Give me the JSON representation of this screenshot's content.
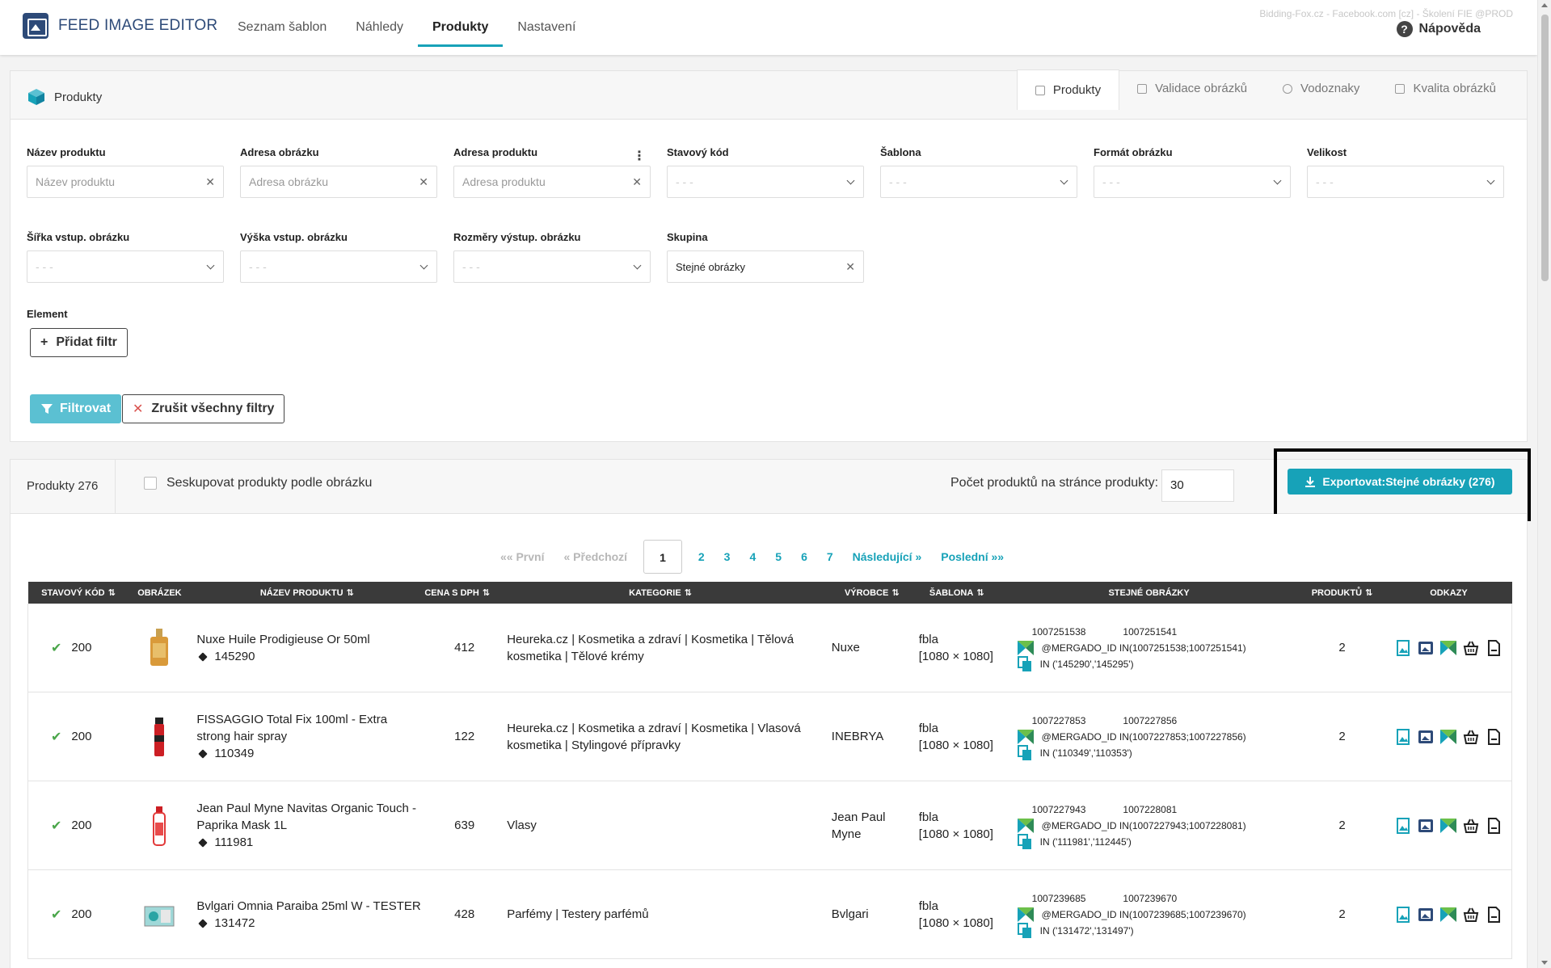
{
  "app": {
    "title": "FEED IMAGE EDITOR",
    "env_label": "Bidding-Fox.cz - Facebook.com [cz] - Školení FIE @PROD",
    "help_label": "Nápověda"
  },
  "nav": [
    {
      "label": "Seznam šablon",
      "active": false
    },
    {
      "label": "Náhledy",
      "active": false
    },
    {
      "label": "Produkty",
      "active": true
    },
    {
      "label": "Nastavení",
      "active": false
    }
  ],
  "card": {
    "title": "Produkty",
    "tabs": [
      {
        "label": "Produkty",
        "active": true
      },
      {
        "label": "Validace obrázků",
        "active": false
      },
      {
        "label": "Vodoznaky",
        "active": false
      },
      {
        "label": "Kvalita obrázků",
        "active": false
      }
    ]
  },
  "filters": {
    "nazev_produktu": {
      "label": "Název produktu",
      "placeholder": "Název produktu"
    },
    "adresa_obrazku": {
      "label": "Adresa obrázku",
      "placeholder": "Adresa obrázku"
    },
    "adresa_produktu": {
      "label": "Adresa produktu",
      "placeholder": "Adresa produktu"
    },
    "stavovy_kod": {
      "label": "Stavový kód",
      "value": "- - -"
    },
    "sablona": {
      "label": "Šablona",
      "value": "- - -"
    },
    "format_obrazku": {
      "label": "Formát obrázku",
      "value": "- - -"
    },
    "velikost": {
      "label": "Velikost",
      "value": "- - -"
    },
    "sirka": {
      "label": "Šířka vstup. obrázku",
      "value": "- - -"
    },
    "vyska": {
      "label": "Výška vstup. obrázku",
      "value": "- - -"
    },
    "rozmery": {
      "label": "Rozměry výstup. obrázku",
      "value": "- - -"
    },
    "skupina": {
      "label": "Skupina",
      "value": "Stejné obrázky"
    },
    "element_label": "Element",
    "add_filter": "Přidat filtr",
    "filter_btn": "Filtrovat",
    "clear_btn": "Zrušit všechny filtry"
  },
  "products_bar": {
    "count_label": "Produkty 276",
    "group_label": "Seskupovat produkty podle obrázku",
    "per_page_label": "Počet produktů na stránce produkty:",
    "per_page_value": "30",
    "export_label": "Exportovat:Stejné obrázky (276)"
  },
  "pager": {
    "first": "«« První",
    "prev": "« Předchozí",
    "pages": [
      "1",
      "2",
      "3",
      "4",
      "5",
      "6",
      "7"
    ],
    "current": "1",
    "next": "Následující »",
    "last": "Poslední »»"
  },
  "table": {
    "headers": [
      "Stavový kód",
      "Obrázek",
      "Název produktu",
      "Cena s DPH",
      "Kategorie",
      "Výrobce",
      "Šablona",
      "Stejné obrázky",
      "Produktů",
      "Odkazy"
    ],
    "rows": [
      {
        "status": "200",
        "name": "Nuxe Huile Prodigieuse Or 50ml",
        "id": "145290",
        "price": "412",
        "category": "Heureka.cz | Kosmetika a zdraví | Kosmetika | Tělová kosmetika | Tělové krémy",
        "maker": "Nuxe",
        "template": "fbla",
        "size": "[1080 × 1080]",
        "same_id1": "1007251538",
        "same_id2": "1007251541",
        "mergado": "@MERGADO_ID IN(1007251538;1007251541)",
        "in": "IN ('145290','145295')",
        "count": "2",
        "thumb": "oil"
      },
      {
        "status": "200",
        "name": "FISSAGGIO Total Fix 100ml - Extra strong hair spray",
        "id": "110349",
        "price": "122",
        "category": "Heureka.cz | Kosmetika a zdraví | Kosmetika | Vlasová kosmetika | Stylingové přípravky",
        "maker": "INEBRYA",
        "template": "fbla",
        "size": "[1080 × 1080]",
        "same_id1": "1007227853",
        "same_id2": "1007227856",
        "mergado": "@MERGADO_ID IN(1007227853;1007227856)",
        "in": "IN ('110349','110353')",
        "count": "2",
        "thumb": "spray"
      },
      {
        "status": "200",
        "name": "Jean Paul Myne Navitas Organic Touch - Paprika Mask 1L",
        "id": "111981",
        "price": "639",
        "category": "Vlasy",
        "maker": "Jean Paul Myne",
        "template": "fbla",
        "size": "[1080 × 1080]",
        "same_id1": "1007227943",
        "same_id2": "1007228081",
        "mergado": "@MERGADO_ID IN(1007227943;1007228081)",
        "in": "IN ('111981','112445')",
        "count": "2",
        "thumb": "bottle"
      },
      {
        "status": "200",
        "name": "Bvlgari Omnia Paraiba 25ml W - TESTER",
        "id": "131472",
        "price": "428",
        "category": "Parfémy | Testery parfémů",
        "maker": "Bvlgari",
        "template": "fbla",
        "size": "[1080 × 1080]",
        "same_id1": "1007239685",
        "same_id2": "1007239670",
        "mergado": "@MERGADO_ID IN(1007239685;1007239670)",
        "in": "IN ('131472','131497')",
        "count": "2",
        "thumb": "box"
      }
    ]
  },
  "colors": {
    "accent": "#17a2b8",
    "header_dark": "#3a3a3a",
    "brand": "#2d4a78"
  }
}
